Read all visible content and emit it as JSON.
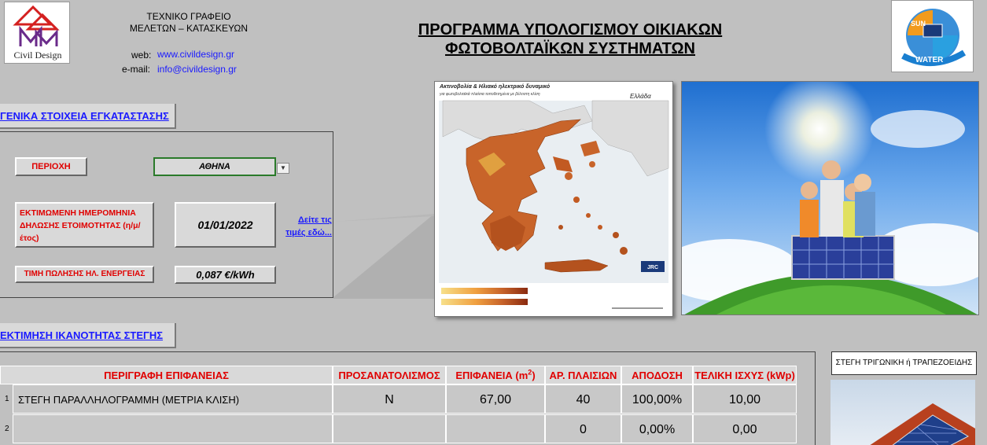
{
  "header": {
    "logo_text": "Civil Design",
    "company_line1": "ΤΕΧΝΙΚΟ ΓΡΑΦΕΙΟ",
    "company_line2": "ΜΕΛΕΤΩΝ – ΚΑΤΑΣΚΕΥΩΝ",
    "web_label": "web:",
    "web_value": "www.civildesign.gr",
    "email_label": "e-mail:",
    "email_value": "info@civildesign.gr",
    "title_line1": "ΠΡΟΓΡΑΜΜΑ ΥΠΟΛΟΓΙΣΜΟΥ ΟΙΚΙΑΚΩΝ",
    "title_line2": "ΦΩΤΟΒΟΛΤΑΪΚΩΝ ΣΥΣΤΗΜΑΤΩΝ",
    "right_logo_sun": "SUN",
    "right_logo_water": "WATER"
  },
  "general": {
    "section_title": "ΓΕΝΙΚΑ ΣΤΟΙΧΕΙΑ ΕΓΚΑΤΑΣΤΑΣΗΣ",
    "region_label": "ΠΕΡΙΟΧΗ",
    "region_value": "ΑΘΗΝΑ",
    "date_label": "ΕΚΤΙΜΩΜΕΝΗ ΗΜΕΡΟΜΗΝΙΑ ΔΗΛΩΣΗΣ ΕΤΟΙΜΟΤΗΤΑΣ (η/μ/έτος)",
    "date_value": "01/01/2022",
    "see_prices_link": "Δείτε τις τιμές εδώ...",
    "price_label": "ΤΙΜΗ ΠΩΛΗΣΗΣ ΗΛ. ΕΝΕΡΓΕΙΑΣ",
    "price_value": "0,087 €/kWh"
  },
  "map": {
    "title": "Ακτινοβολία & Ηλιακό ηλεκτρικό δυναμικό",
    "subtitle": "για φωτοβολταϊκά πλαίσια τοποθετημένα με βέλτιστη κλίση",
    "country": "Ελλάδα",
    "jrc": "JRC"
  },
  "roof": {
    "section_title": "ΕΚΤΙΜΗΣΗ ΙΚΑΝΟΤΗΤΑΣ ΣΤΕΓΗΣ",
    "side_label": "ΣΤΕΓΗ ΤΡΙΓΩΝΙΚΗ ή ΤΡΑΠΕΖΟΕΙΔΗΣ",
    "columns": {
      "description": "ΠΕΡΙΓΡΑΦΗ ΕΠΙΦΑΝΕΙΑΣ",
      "orientation": "ΠΡΟΣΑΝΑΤΟΛΙΣΜΟΣ",
      "area": "ΕΠΙΦΑΝΕΙΑ (m",
      "area_sup": "2",
      "area_close": ")",
      "panels": "ΑΡ. ΠΛΑΙΣΙΩΝ",
      "efficiency": "ΑΠΟΔΟΣΗ",
      "power": "ΤΕΛΙΚΗ ΙΣΧΥΣ (kWp)"
    },
    "rows": [
      {
        "num": "1",
        "description": "ΣΤΕΓΗ ΠΑΡΑΛΛΗΛΟΓΡΑΜΜΗ (ΜΕΤΡΙΑ ΚΛΙΣΗ)",
        "orientation": "N",
        "area": "67,00",
        "panels": "40",
        "efficiency": "100,00%",
        "power": "10,00"
      },
      {
        "num": "2",
        "description": "",
        "orientation": "",
        "area": "",
        "panels": "0",
        "efficiency": "0,00%",
        "power": "0,00"
      }
    ]
  }
}
